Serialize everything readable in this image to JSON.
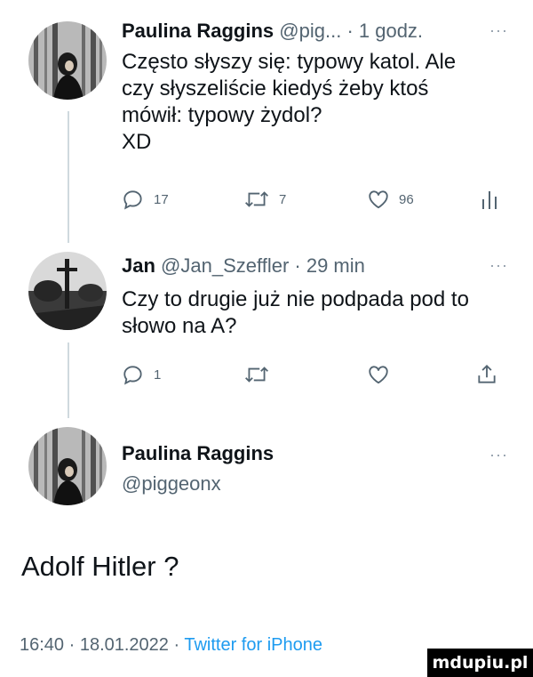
{
  "tweet1": {
    "name": "Paulina Raggins",
    "handle": "@pig...",
    "time": "· 1 godz.",
    "more": "···",
    "text_lines": [
      "Często słyszy się: typowy katol. Ale",
      "czy słyszeliście kiedyś żeby ktoś",
      "mówił: typowy żydol?",
      "XD"
    ],
    "actions": {
      "replies": "17",
      "retweets": "7",
      "likes": "96"
    },
    "avatar_icon": "avatar-woman-forest-icon"
  },
  "tweet2": {
    "name": "Jan",
    "handle": "@Jan_Szeffler",
    "time": "· 29 min",
    "more": "···",
    "text_lines": [
      "Czy to drugie już nie podpada pod to",
      "słowo na A?"
    ],
    "actions": {
      "replies": "1"
    },
    "avatar_icon": "avatar-cross-landscape-icon"
  },
  "quoted": {
    "name": "Paulina Raggins",
    "handle": "@piggeonx",
    "more": "···",
    "text": "Adolf Hitler ?",
    "meta_time": "16:40 · 18.01.2022 ·",
    "meta_client": "Twitter for iPhone"
  },
  "watermark": "mdupiu.pl",
  "colors": {
    "text": "#0f1419",
    "secondary": "#536471",
    "line": "#cfd9de",
    "link": "#1d9bf0"
  }
}
